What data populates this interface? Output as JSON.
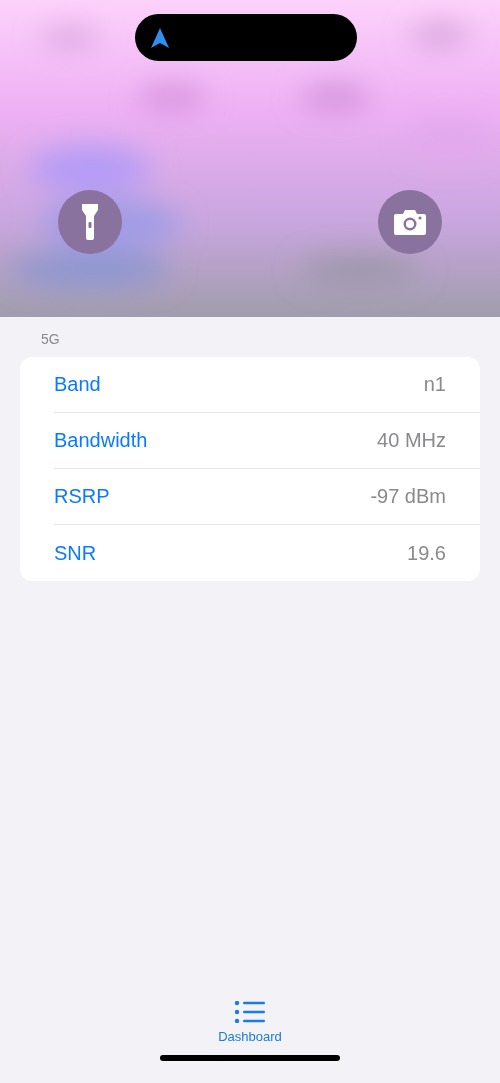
{
  "section": {
    "title": "5G",
    "rows": [
      {
        "label": "Band",
        "value": "n1"
      },
      {
        "label": "Bandwidth",
        "value": "40 MHz"
      },
      {
        "label": "RSRP",
        "value": "-97 dBm"
      },
      {
        "label": "SNR",
        "value": "19.6"
      }
    ]
  },
  "tab_bar": {
    "items": [
      {
        "label": "Dashboard",
        "selected": true
      }
    ]
  }
}
